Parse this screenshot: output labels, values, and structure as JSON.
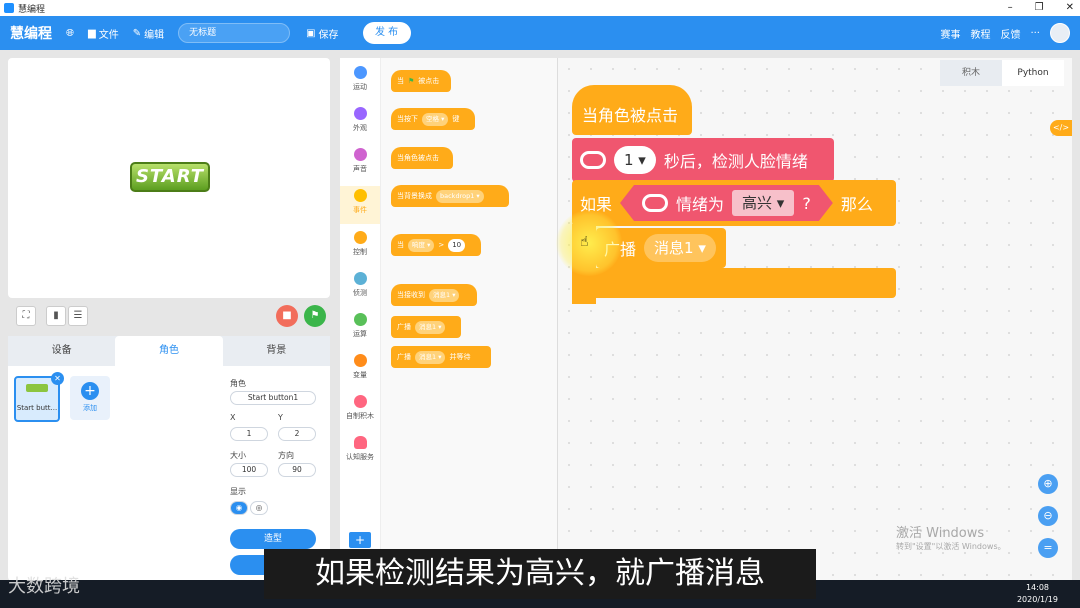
{
  "window": {
    "title": "慧编程"
  },
  "menubar": {
    "brand": "慧编程",
    "file": "文件",
    "edit": "编辑",
    "project_title": "无标题",
    "save": "保存",
    "publish": "发 布",
    "right": [
      "赛事",
      "教程",
      "反馈",
      "···"
    ]
  },
  "stage": {
    "sprite_label": "START"
  },
  "sprite_panel": {
    "tabs": [
      "设备",
      "角色",
      "背景"
    ],
    "sprite_name": "Start butt...",
    "add_label": "添加",
    "role_label": "角色",
    "role_value": "Start button1",
    "x_label": "X",
    "x_value": "1",
    "y_label": "Y",
    "y_value": "2",
    "size_label": "大小",
    "size_value": "100",
    "dir_label": "方向",
    "dir_value": "90",
    "show_label": "显示",
    "costume_btn": "造型",
    "sound_btn": "声音"
  },
  "categories": [
    {
      "label": "运动",
      "color": "#4c97ff"
    },
    {
      "label": "外观",
      "color": "#9966ff"
    },
    {
      "label": "声音",
      "color": "#cf63cf"
    },
    {
      "label": "事件",
      "color": "#ffbf00"
    },
    {
      "label": "控制",
      "color": "#ffab19"
    },
    {
      "label": "侦测",
      "color": "#5cb1d6"
    },
    {
      "label": "运算",
      "color": "#59c059"
    },
    {
      "label": "变量",
      "color": "#ff8c1a"
    },
    {
      "label": "自制积木",
      "color": "#ff6680"
    },
    {
      "label": "认知服务",
      "color": "#ff6680"
    }
  ],
  "palette": {
    "b1": "当",
    "b1b": "被点击",
    "b2a": "当按下",
    "b2b": "空格 ▾",
    "b2c": "键",
    "b3": "当角色被点击",
    "b4a": "当背景换成",
    "b4b": "backdrop1 ▾",
    "b5a": "当",
    "b5b": "响度 ▾",
    "b5c": "> ",
    "b5d": "10",
    "b6a": "当接收到",
    "b6b": "消息1 ▾",
    "b7a": "广播",
    "b7b": "消息1 ▾",
    "b8a": "广播",
    "b8b": "消息1 ▾",
    "b8c": "并等待"
  },
  "workspace": {
    "tabs": [
      "积木",
      "Python"
    ],
    "hat": "当角色被点击",
    "wait_num": "1 ▾",
    "wait_text": "秒后，检测人脸情绪",
    "if_label": "如果",
    "cond_text": "情绪为",
    "cond_value": "高兴 ▾",
    "cond_q": "?",
    "then_label": "那么",
    "bc_label": "广播",
    "bc_value": "消息1 ▾"
  },
  "watermark": {
    "line1": "激活 Windows",
    "line2": "转到\"设置\"以激活 Windows。"
  },
  "subtitle": "如果检测结果为高兴，就广播消息",
  "logo_watermark": "大数跨境",
  "clock": {
    "time": "14:08",
    "date": "2020/1/19"
  }
}
